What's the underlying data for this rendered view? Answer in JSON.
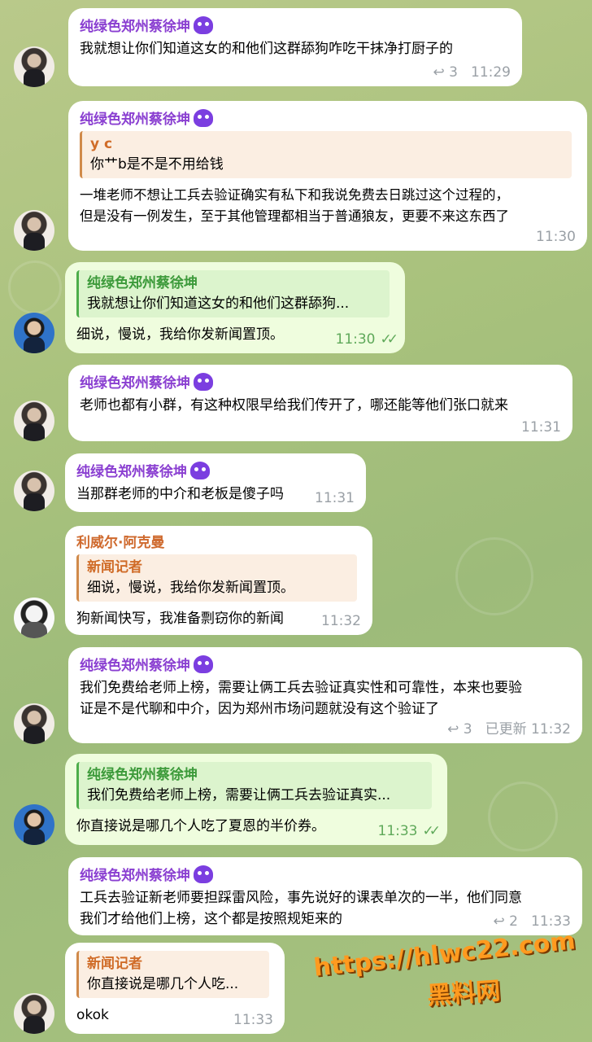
{
  "messages": [
    {
      "sender": "纯绿色郑州蔡徐坤",
      "text": "我就想让你们知道这女的和他们这群舔狗咋吃干抹净打厨子的",
      "replies": "3",
      "time": "11:29"
    },
    {
      "sender": "纯绿色郑州蔡徐坤",
      "quote_name": "y c",
      "quote_text": "你艹b是不是不用给钱",
      "text": "一堆老师不想让工兵去验证确实有私下和我说免费去日跳过这个过程的，\n但是没有一例发生，至于其他管理都相当于普通狼友，更要不来这东西了",
      "time": "11:30"
    },
    {
      "quote_name": "纯绿色郑州蔡徐坤",
      "quote_text": "我就想让你们知道这女的和他们这群舔狗...",
      "text": "细说，慢说，我给你发新闻置顶。",
      "time": "11:30",
      "check": "✓✓"
    },
    {
      "sender": "纯绿色郑州蔡徐坤",
      "text": "老师也都有小群，有这种权限早给我们传开了，哪还能等他们张口就来",
      "time": "11:31"
    },
    {
      "sender": "纯绿色郑州蔡徐坤",
      "text": "当那群老师的中介和老板是傻子吗",
      "time": "11:31"
    },
    {
      "sender": "利威尔·阿克曼",
      "quote_name": "新闻记者",
      "quote_text": "细说，慢说，我给你发新闻置顶。",
      "text": "狗新闻快写，我准备剽窃你的新闻",
      "time": "11:32"
    },
    {
      "sender": "纯绿色郑州蔡徐坤",
      "text": "我们免费给老师上榜，需要让俩工兵去验证真实性和可靠性，本来也要验\n证是不是代聊和中介，因为郑州市场问题就没有这个验证了",
      "replies": "3",
      "time": "已更新 11:32"
    },
    {
      "quote_name": "纯绿色郑州蔡徐坤",
      "quote_text": "我们免费给老师上榜，需要让俩工兵去验证真实...",
      "text": "你直接说是哪几个人吃了夏恩的半价券。",
      "time": "11:33",
      "check": "✓✓"
    },
    {
      "sender": "纯绿色郑州蔡徐坤",
      "text": "工兵去验证新老师要担踩雷风险，事先说好的课表单次的一半，他们同意\n我们才给他们上榜，这个都是按照规矩来的",
      "replies": "2",
      "time": "11:33"
    },
    {
      "quote_name": "新闻记者",
      "quote_text": "你直接说是哪几个人吃...",
      "text": "okok",
      "time": "11:33"
    }
  ],
  "watermark": {
    "url": "https://hlwc22.com",
    "name": "黑料网"
  },
  "reply_icon": "reply-arrow-icon",
  "colors": {
    "sender_purple": "#8a3fd1",
    "sender_orange": "#cf6a2e",
    "outgoing_bg": "#effdde"
  }
}
